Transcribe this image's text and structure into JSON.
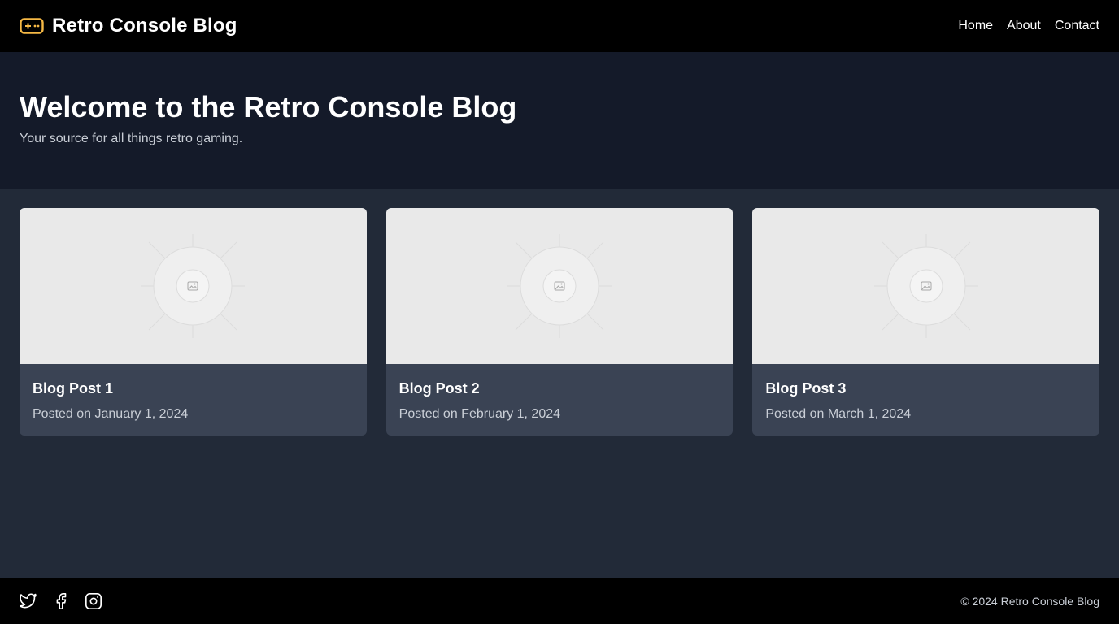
{
  "header": {
    "brand_title": "Retro Console Blog",
    "brand_icon": "gamepad-icon",
    "nav": [
      "Home",
      "About",
      "Contact"
    ]
  },
  "hero": {
    "title": "Welcome to the Retro Console Blog",
    "subtitle": "Your source for all things retro gaming."
  },
  "posts": [
    {
      "title": "Blog Post 1",
      "date": "Posted on January 1, 2024",
      "image_icon": "image-placeholder-icon"
    },
    {
      "title": "Blog Post 2",
      "date": "Posted on February 1, 2024",
      "image_icon": "image-placeholder-icon"
    },
    {
      "title": "Blog Post 3",
      "date": "Posted on March 1, 2024",
      "image_icon": "image-placeholder-icon"
    }
  ],
  "footer": {
    "social_icons": [
      "twitter-icon",
      "facebook-icon",
      "instagram-icon"
    ],
    "copyright": "© 2024 Retro Console Blog"
  },
  "colors": {
    "header_bg": "#000000",
    "hero_bg": "#141a29",
    "page_bg": "#222a38",
    "card_bg": "#3a4354",
    "accent": "#f5b845"
  }
}
